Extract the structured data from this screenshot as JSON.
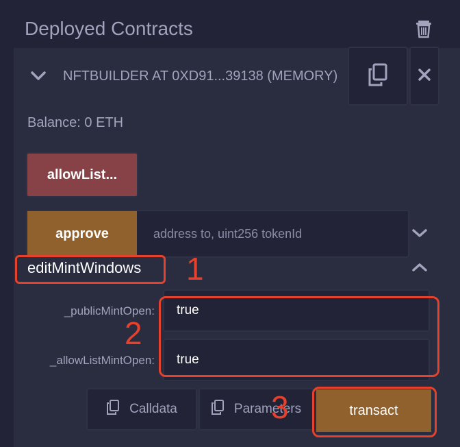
{
  "header": {
    "title": "Deployed Contracts",
    "trash_icon": "trash-icon"
  },
  "contract": {
    "name": "NFTBUILDER AT 0XD91...39138 (MEMORY)",
    "balance": "Balance: 0 ETH"
  },
  "functions": {
    "allowlist_label": "allowList...",
    "approve_label": "approve",
    "approve_placeholder": "address to, uint256 tokenId",
    "edit_title": "editMintWindows",
    "params": [
      {
        "label": "_publicMintOpen:",
        "value": "true"
      },
      {
        "label": "_allowListMintOpen:",
        "value": "true"
      }
    ],
    "calldata_label": "Calldata",
    "parameters_label": "Parameters",
    "transact_label": "transact"
  },
  "annotations": {
    "step1": "1",
    "step2": "2",
    "step3": "3",
    "color": "#e6412d"
  },
  "colors": {
    "background": "#222336",
    "panel": "#2a2c3f",
    "allowlist_button": "#864246",
    "transact_button": "#90602d"
  }
}
